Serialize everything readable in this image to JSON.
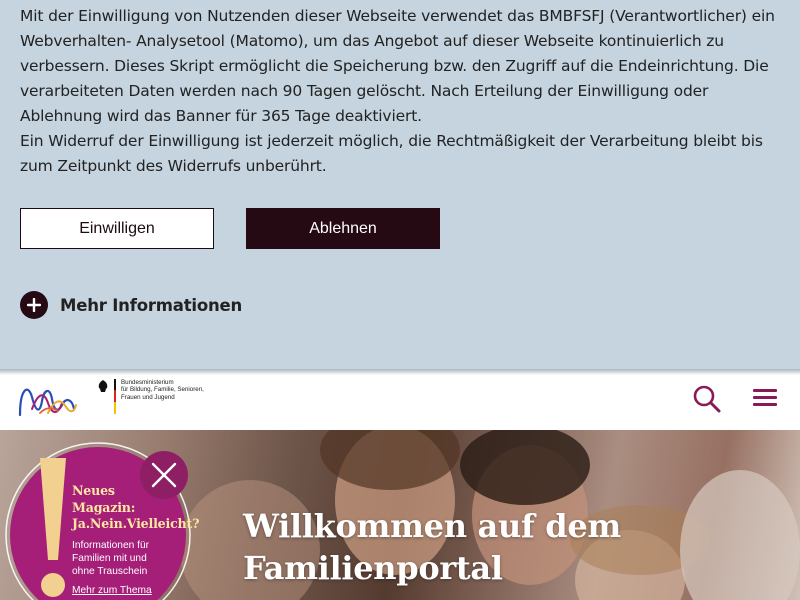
{
  "consent": {
    "paragraphs": [
      "Mit der Einwilligung von Nutzenden dieser Webseite verwendet das BMBFSFJ (Verantwortlicher) ein Webverhalten- Analysetool (Matomo), um das Angebot auf dieser Webseite kontinuierlich zu verbessern. Dieses Skript ermöglicht die Speicherung bzw. den Zugriff auf die Endeinrichtung. Die verarbeiteten Daten werden nach 90 Tagen gelöscht. Nach Erteilung der Einwilligung oder Ablehnung wird das Banner für 365 Tage deaktiviert.",
      "Ein Widerruf der Einwilligung ist jederzeit möglich, die Rechtmäßigkeit der Verarbeitung bleibt bis zum Zeitpunkt des Widerrufs unberührt."
    ],
    "accept_label": "Einwilligen",
    "decline_label": "Ablehnen",
    "more_info_label": "Mehr Informationen",
    "colors": {
      "background": "#c5d4df",
      "primary_dark": "#250913"
    }
  },
  "header": {
    "ministry_lines": [
      "Bundesministerium",
      "für Bildung, Familie, Senioren,",
      "Frauen und Jugend"
    ],
    "icons": {
      "search": "search-icon",
      "menu": "hamburger-menu-icon",
      "logo": "familienportal-wave-logo",
      "eagle": "federal-eagle-icon"
    },
    "accent_color": "#8a1a55"
  },
  "hero": {
    "title_lines": [
      "Willkommen auf dem",
      "Familienportal"
    ]
  },
  "teaser": {
    "title_lines": [
      "Neues",
      "Magazin:",
      "Ja.Nein.Vielleicht?"
    ],
    "text": "Informationen für Familien mit und ohne Trauschein",
    "link_label": "Mehr zum Thema",
    "colors": {
      "bubble": "#a51e78",
      "title": "#fde7a4",
      "exclamation": "#f2d08f"
    }
  }
}
